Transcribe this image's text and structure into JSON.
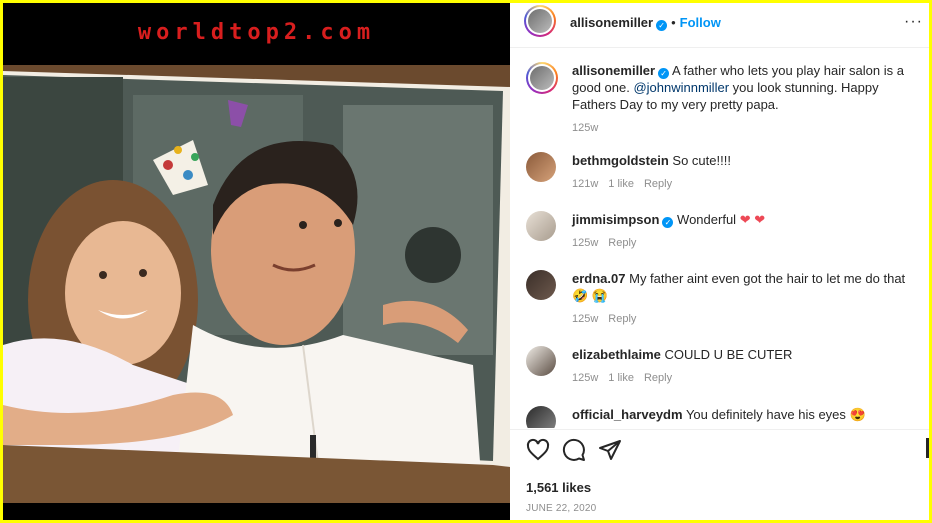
{
  "watermark": "worldtop2.com",
  "post": {
    "author": "allisonemiller",
    "follow_label": "Follow",
    "separator": "•",
    "more_icon": "more-options-icon",
    "caption_prefix": " A father who lets you play hair salon is a good one. ",
    "caption_mention": "@johnwinnmiller",
    "caption_suffix": " you look stunning. Happy Fathers Day to my very pretty papa.",
    "caption_time": "125w"
  },
  "comments": [
    {
      "user": "bethmgoldstein",
      "text": "So cute!!!!",
      "time": "121w",
      "likes": "1 like",
      "reply": "Reply",
      "verified": false
    },
    {
      "user": "jimmisimpson",
      "text": "Wonderful",
      "emoji": "❤ ❤",
      "time": "125w",
      "likes": "",
      "reply": "Reply",
      "verified": true
    },
    {
      "user": "erdna.07",
      "text": "My father aint even got the hair to let me do that",
      "emoji": "🤣 😭",
      "time": "125w",
      "likes": "",
      "reply": "Reply",
      "verified": false
    },
    {
      "user": "elizabethlaime",
      "text": "COULD U BE CUTER",
      "time": "125w",
      "likes": "1 like",
      "reply": "Reply",
      "verified": false
    },
    {
      "user": "official_harveydm",
      "text": "You definitely have his eyes",
      "emoji": "😍",
      "time": "",
      "likes": "",
      "reply": "",
      "verified": false
    }
  ],
  "actions": {
    "like_icon": "heart-icon",
    "comment_icon": "comment-icon",
    "share_icon": "share-icon",
    "likes_count": "1,561 likes",
    "date": "JUNE 22, 2020"
  },
  "colors": {
    "border": "#ffff00",
    "accent": "#0095f6",
    "watermark": "#d81e1e"
  }
}
